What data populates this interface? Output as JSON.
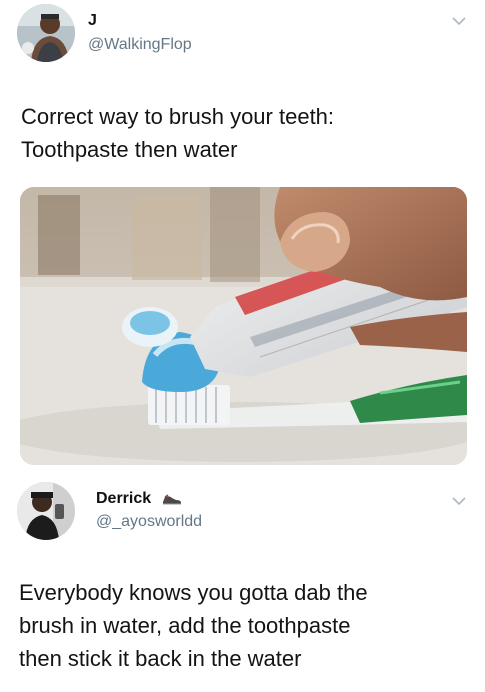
{
  "tweet1": {
    "author_name": "J",
    "author_handle": "@WalkingFlop",
    "text_line1": "Correct way to brush your teeth:",
    "text_line2": "Toothpaste then water",
    "media_alt": "photo of toothpaste being squeezed onto a toothbrush",
    "icons": [
      "avatar",
      "chevron-down-icon"
    ]
  },
  "tweet2": {
    "author_name": "Derrick",
    "author_handle": "@_ayosworldd",
    "text_line1": "Everybody knows you gotta dab the",
    "text_line2": "brush in water, add the toothpaste",
    "text_line3": "then stick it back in the water",
    "icons": [
      "avatar",
      "sneaker-emoji-icon",
      "chevron-down-icon"
    ]
  },
  "colors": {
    "handle": "#657786",
    "text": "#141414",
    "chevron": "#aab8c2"
  }
}
